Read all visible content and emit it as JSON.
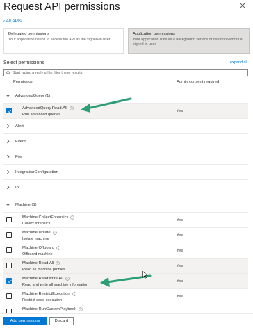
{
  "panel": {
    "title": "Request API permissions"
  },
  "nav": {
    "back_label": "All APIs"
  },
  "perm_types": [
    {
      "title": "Delegated permissions",
      "desc": "Your application needs to access the API as the signed-in user.",
      "selected": false
    },
    {
      "title": "Application permissions",
      "desc": "Your application runs as a background service or daemon without a signed-in user.",
      "selected": true
    }
  ],
  "select_section": {
    "label": "Select permissions",
    "expand_all": "expand all"
  },
  "search": {
    "placeholder": "Start typing a reply url to filter these results."
  },
  "table": {
    "col_permission": "Permission",
    "col_admin": "Admin consent required"
  },
  "groups": {
    "advanced_query": "AdvancedQuery (1)",
    "alert": "Alert",
    "event": "Event",
    "file": "File",
    "integration": "IntegrationConfiguration",
    "ip": "Ip",
    "machine": "Machine (1)"
  },
  "advanced_permission": {
    "name": "AdvancedQuery.Read.All",
    "desc": "Run advanced queries",
    "admin": "Yes",
    "checked": true
  },
  "machine_permissions": [
    {
      "name": "Machine.CollectForensics",
      "desc": "Collect forensics",
      "admin": "Yes",
      "checked": false
    },
    {
      "name": "Machine.Isolate",
      "desc": "Isolate machine",
      "admin": "Yes",
      "checked": false
    },
    {
      "name": "Machine.Offboard",
      "desc": "Offboard machine",
      "admin": "Yes",
      "checked": false
    },
    {
      "name": "Machine.Read.All",
      "desc": "Read all machine profiles",
      "admin": "Yes",
      "checked": false
    },
    {
      "name": "Machine.ReadWrite.All",
      "desc": "Read and write all machine information",
      "admin": "Yes",
      "checked": true
    },
    {
      "name": "Machine.RestrictExecution",
      "desc": "Restrict code execution",
      "admin": "Yes",
      "checked": false
    },
    {
      "name": "Machine.RunCustomPlaybook",
      "desc": "",
      "admin": "",
      "checked": false
    }
  ],
  "footer": {
    "add_label": "Add permissions",
    "discard_label": "Discard"
  },
  "colors": {
    "accent": "#0078d4",
    "annotation_arrow": "#2e9e78",
    "selected_card": "#e1dfdd"
  },
  "icons": [
    "close-icon",
    "chevron-left-icon",
    "search-icon",
    "chevron-down-icon",
    "chevron-right-icon",
    "info-icon",
    "checkmark-icon",
    "mouse-cursor-icon",
    "annotation-arrow"
  ]
}
